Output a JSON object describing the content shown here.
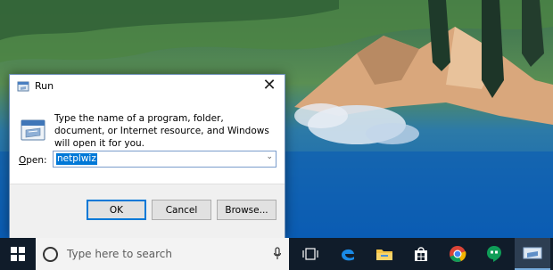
{
  "dialog": {
    "title": "Run",
    "close_glyph": "✕",
    "description": "Type the name of a program, folder, document, or Internet resource, and Windows will open it for you.",
    "open_label_prefix": "",
    "open_label_mnemonic": "O",
    "open_label_rest": "pen:",
    "open_value": "netplwiz",
    "buttons": {
      "ok": "OK",
      "cancel": "Cancel",
      "browse": "Browse..."
    }
  },
  "taskbar": {
    "search_placeholder": "Type here to search",
    "icons": [
      "windows-start-icon",
      "cortana-icon",
      "microphone-icon",
      "task-view-icon",
      "edge-icon",
      "file-explorer-icon",
      "store-icon",
      "chrome-icon",
      "hangouts-icon",
      "run-app-icon"
    ]
  },
  "colors": {
    "accent": "#0078d7",
    "taskbar": "#101c2a"
  }
}
